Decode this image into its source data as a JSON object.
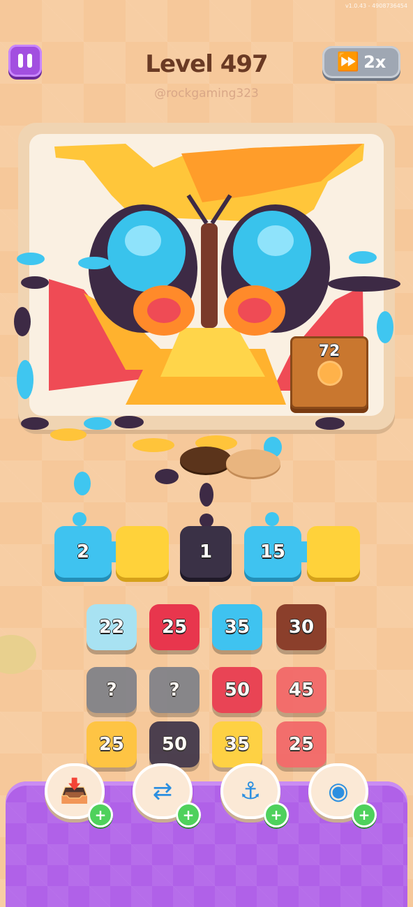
{
  "header": {
    "version": "v1.0.43 - 4908736454",
    "level_title": "Level 497",
    "username": "@rockgaming323",
    "speed_label": "2x"
  },
  "board": {
    "chest_count": "72"
  },
  "queue": [
    {
      "value": "2",
      "color": "#3fc3f0"
    },
    {
      "value": "",
      "color": "#ffd23a"
    },
    {
      "value": "1",
      "color": "#3a3146"
    },
    {
      "value": "15",
      "color": "#3fc3f0"
    },
    {
      "value": "",
      "color": "#ffd23a"
    }
  ],
  "grid": [
    [
      {
        "value": "22",
        "color": "#a8e2f2"
      },
      {
        "value": "25",
        "color": "#e8364d"
      },
      {
        "value": "35",
        "color": "#3fc3f0"
      },
      {
        "value": "30",
        "color": "#8b3f2b"
      }
    ],
    [
      {
        "value": "?",
        "color": "#7c7f88"
      },
      {
        "value": "?",
        "color": "#7c7f88"
      },
      {
        "value": "50",
        "color": "#e8364d"
      },
      {
        "value": "45",
        "color": "#f26466"
      }
    ],
    [
      {
        "value": "25",
        "color": "#ffc43a"
      },
      {
        "value": "50",
        "color": "#3a3146"
      },
      {
        "value": "35",
        "color": "#ffd23a"
      },
      {
        "value": "25",
        "color": "#f26466"
      }
    ]
  ],
  "boosters": [
    {
      "name": "add-slot",
      "icon": "tray-plus-icon"
    },
    {
      "name": "shuffle",
      "icon": "shuffle-arrows-icon"
    },
    {
      "name": "magnet",
      "icon": "claw-magnet-icon"
    },
    {
      "name": "vacuum",
      "icon": "hose-icon"
    }
  ]
}
